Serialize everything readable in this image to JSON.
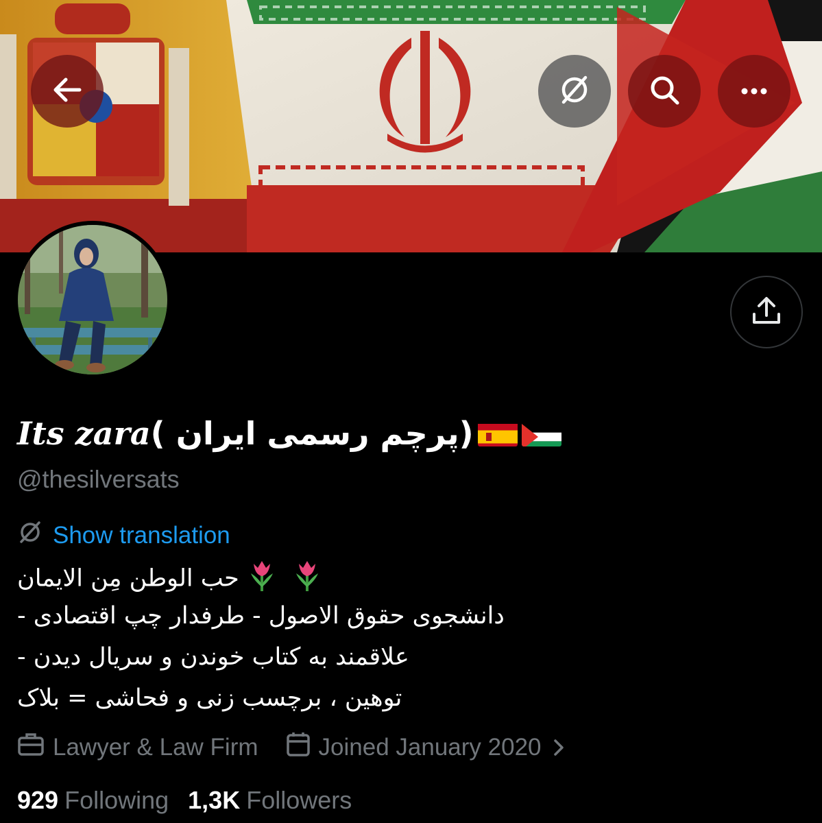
{
  "profile": {
    "name_latin": "Its zara",
    "name_persian": "(پرچم رسمی ایران )",
    "handle": "@thesilversats"
  },
  "translation": {
    "label": "Show translation"
  },
  "bio": {
    "line1": "حب الوطن مِن الایمان",
    "line2": "دانشجوی حقوق الاصول - طرفدار چپ اقتصادی -",
    "line3": "علاقمند به کتاب خوندن و سریال دیدن -",
    "line4": "توهین ، برچسب زنی و فحاشی = بلاک"
  },
  "meta": {
    "category": "Lawyer & Law Firm",
    "joined": "Joined January 2020"
  },
  "stats": {
    "following_count": "929",
    "following_label": "Following",
    "followers_count": "1,3K",
    "followers_label": "Followers"
  },
  "icons": {
    "back": "arrow-left-icon",
    "translate": "globe-slash-icon",
    "search": "search-icon",
    "more": "more-dots-icon",
    "share": "share-upload-icon",
    "briefcase": "briefcase-icon",
    "calendar": "calendar-icon",
    "chevron": "chevron-right-icon"
  },
  "colors": {
    "background": "#000000",
    "link": "#1d9bf0",
    "muted": "#71767b",
    "text": "#e7e9ea"
  }
}
